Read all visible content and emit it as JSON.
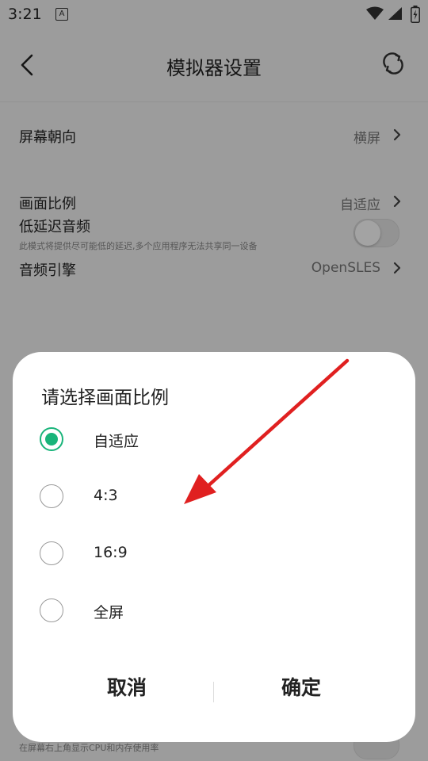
{
  "status_bar": {
    "time": "3:21",
    "notification_icon_letter": "A"
  },
  "header": {
    "title": "模拟器设置",
    "back_icon": "chevron-left-icon",
    "refresh_icon": "refresh-icon"
  },
  "settings": {
    "rows": [
      {
        "label": "屏幕朝向",
        "value": "横屏"
      },
      {
        "label": "画面比例",
        "value": "自适应"
      },
      {
        "label": "音频引擎",
        "value": "OpenSLES"
      }
    ],
    "low_latency": {
      "label": "低延迟音频",
      "description": "此模式将提供尽可能低的延迟,多个应用程序无法共享同一设备",
      "enabled": false
    },
    "bottom_description": "在屏幕右上角显示CPU和内存使用率"
  },
  "dialog": {
    "title": "请选择画面比例",
    "options": [
      {
        "label": "自适应",
        "selected": true
      },
      {
        "label": "4:3",
        "selected": false
      },
      {
        "label": "16:9",
        "selected": false
      },
      {
        "label": "全屏",
        "selected": false
      }
    ],
    "cancel_label": "取消",
    "confirm_label": "确定"
  },
  "colors": {
    "accent": "#19b47a",
    "annotation_arrow": "#e02020"
  }
}
